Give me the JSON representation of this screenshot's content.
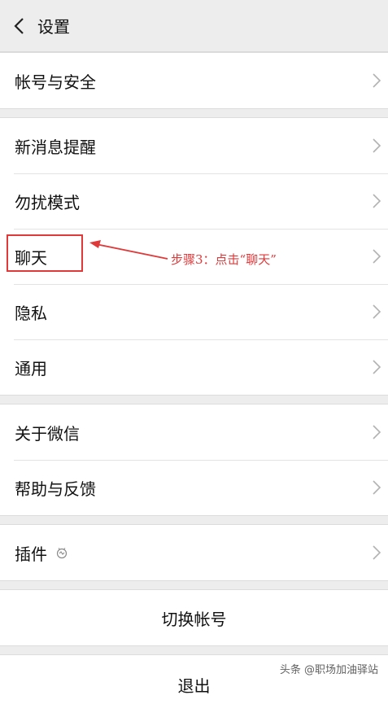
{
  "header": {
    "title": "设置"
  },
  "groups": [
    {
      "items": [
        {
          "label": "帐号与安全"
        }
      ]
    },
    {
      "items": [
        {
          "label": "新消息提醒"
        },
        {
          "label": "勿扰模式"
        },
        {
          "label": "聊天"
        },
        {
          "label": "隐私"
        },
        {
          "label": "通用"
        }
      ]
    },
    {
      "items": [
        {
          "label": "关于微信"
        },
        {
          "label": "帮助与反馈"
        }
      ]
    },
    {
      "items": [
        {
          "label": "插件"
        }
      ]
    }
  ],
  "buttons": {
    "switch_account": "切换帐号",
    "logout": "退出"
  },
  "annotation": {
    "text": "步骤3：点击“聊天”",
    "color": "#e0393a"
  },
  "watermark": "头条 @职场加油驿站",
  "icons": {
    "back": "chevron-left-icon",
    "row_arrow": "chevron-right-icon",
    "plugin": "plugin-badge-icon"
  }
}
